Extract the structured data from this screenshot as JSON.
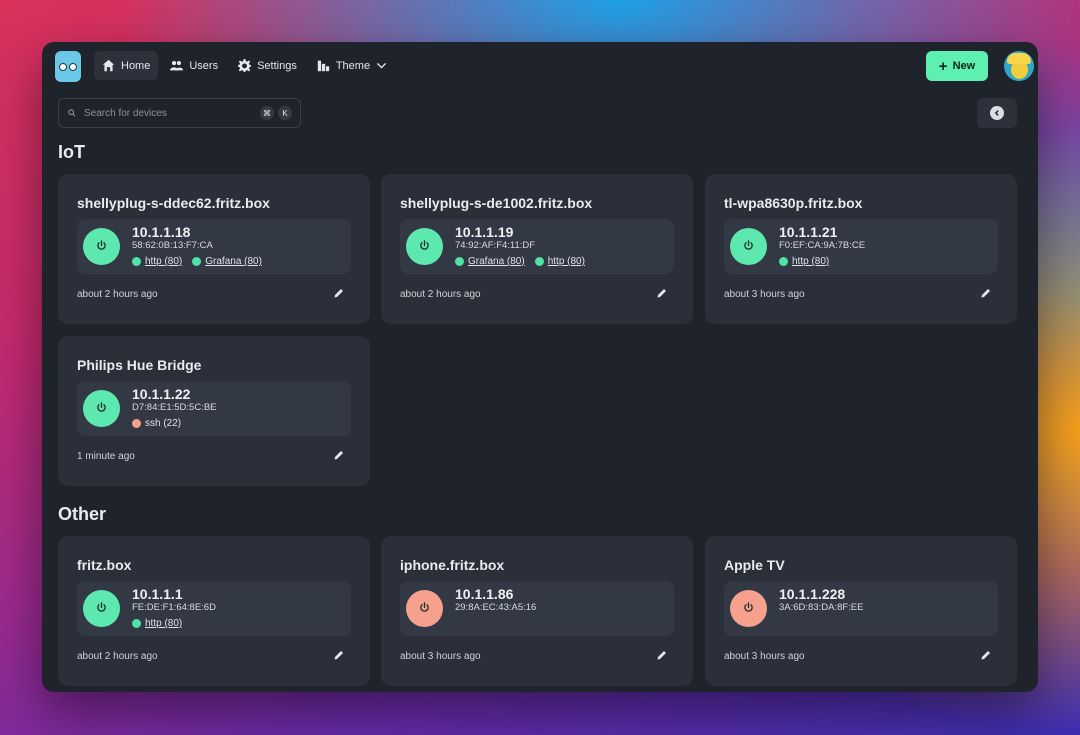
{
  "colors": {
    "accent": "#5df0b0",
    "online": "#5de8b0",
    "offline": "#f5a18e",
    "service_up": "#4fe3a8",
    "service_down": "#f5a18e"
  },
  "nav": {
    "home": {
      "label": "Home",
      "icon": "home-icon"
    },
    "users": {
      "label": "Users",
      "icon": "users-icon"
    },
    "settings": {
      "label": "Settings",
      "icon": "gear-icon"
    },
    "theme": {
      "label": "Theme",
      "icon": "palette-icon"
    }
  },
  "new_button": {
    "label": "New",
    "icon": "plus-icon"
  },
  "search": {
    "placeholder": "Search for devices",
    "shortcut_mod": "⌘",
    "shortcut_key": "K"
  },
  "sections": [
    {
      "title": "IoT",
      "devices": [
        {
          "name": "shellyplug-s-ddec62.fritz.box",
          "ip": "10.1.1.18",
          "mac": "58:62:0B:13:F7:CA",
          "online": true,
          "services": [
            {
              "label": "http (80)",
              "up": true,
              "link": true
            },
            {
              "label": "Grafana (80)",
              "up": true,
              "link": true
            }
          ],
          "last_seen": "about 2 hours ago"
        },
        {
          "name": "shellyplug-s-de1002.fritz.box",
          "ip": "10.1.1.19",
          "mac": "74:92:AF:F4:11:DF",
          "online": true,
          "services": [
            {
              "label": "Grafana (80)",
              "up": true,
              "link": true
            },
            {
              "label": "http (80)",
              "up": true,
              "link": true
            }
          ],
          "last_seen": "about 2 hours ago"
        },
        {
          "name": "tl-wpa8630p.fritz.box",
          "ip": "10.1.1.21",
          "mac": "F0:EF:CA:9A:7B:CE",
          "online": true,
          "services": [
            {
              "label": "http (80)",
              "up": true,
              "link": true
            }
          ],
          "last_seen": "about 3 hours ago"
        },
        {
          "name": "Philips Hue Bridge",
          "ip": "10.1.1.22",
          "mac": "D7:84:E1:5D:5C:BE",
          "online": true,
          "services": [
            {
              "label": "ssh (22)",
              "up": false,
              "link": false
            }
          ],
          "last_seen": "1 minute ago"
        }
      ]
    },
    {
      "title": "Other",
      "devices": [
        {
          "name": "fritz.box",
          "ip": "10.1.1.1",
          "mac": "FE:DE:F1:64:8E:6D",
          "online": true,
          "services": [
            {
              "label": "http (80)",
              "up": true,
              "link": true
            }
          ],
          "last_seen": "about 2 hours ago"
        },
        {
          "name": "iphone.fritz.box",
          "ip": "10.1.1.86",
          "mac": "29:8A:EC:43:A5:16",
          "online": false,
          "services": [],
          "last_seen": "about 3 hours ago"
        },
        {
          "name": "Apple TV",
          "ip": "10.1.1.228",
          "mac": "3A:6D:83:DA:8F:EE",
          "online": false,
          "services": [],
          "last_seen": "about 3 hours ago"
        }
      ]
    }
  ]
}
